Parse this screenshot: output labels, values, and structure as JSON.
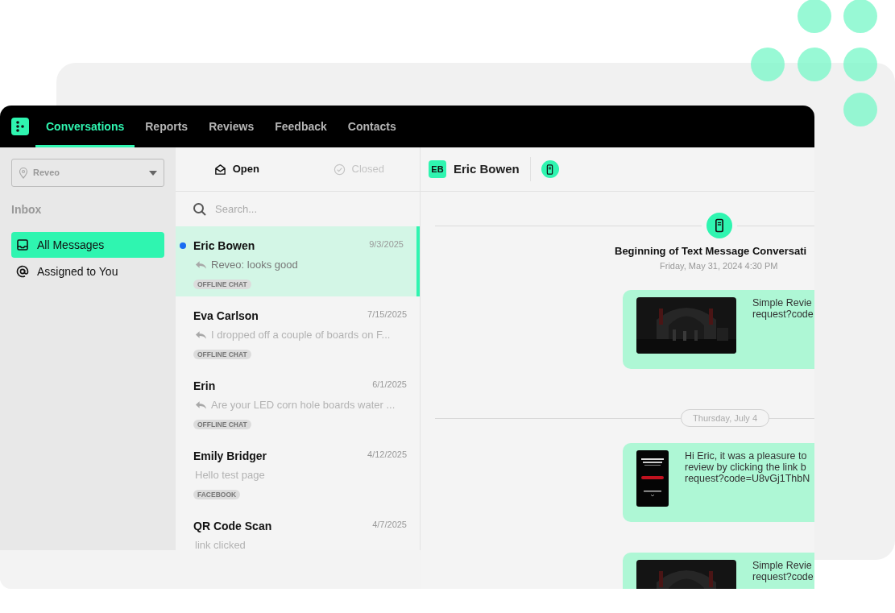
{
  "nav": {
    "tabs": [
      {
        "label": "Conversations",
        "selected": true
      },
      {
        "label": "Reports",
        "selected": false
      },
      {
        "label": "Reviews",
        "selected": false
      },
      {
        "label": "Feedback",
        "selected": false
      },
      {
        "label": "Contacts",
        "selected": false
      }
    ]
  },
  "sidebar": {
    "location": "Reveo",
    "heading": "Inbox",
    "items": [
      {
        "label": "All Messages",
        "kind": "inbox",
        "selected": true
      },
      {
        "label": "Assigned to You",
        "kind": "mention",
        "selected": false
      }
    ]
  },
  "filters": [
    {
      "label": "Open",
      "kind": "open",
      "selected": true
    },
    {
      "label": "Closed",
      "kind": "closed",
      "selected": false
    }
  ],
  "search": {
    "placeholder": "Search..."
  },
  "conversations": [
    {
      "name": "Eric Bowen",
      "date": "9/3/2025",
      "preview": "Reveo: looks good",
      "reply": true,
      "tag": "OFFLINE CHAT",
      "unread": true,
      "selected": true
    },
    {
      "name": "Eva Carlson",
      "date": "7/15/2025",
      "preview": "I dropped off a couple of boards on F...",
      "reply": true,
      "tag": "OFFLINE CHAT",
      "unread": false,
      "selected": false
    },
    {
      "name": "Erin",
      "date": "6/1/2025",
      "preview": "Are your LED corn hole boards water ...",
      "reply": true,
      "tag": "OFFLINE CHAT",
      "unread": false,
      "selected": false
    },
    {
      "name": "Emily Bridger",
      "date": "4/12/2025",
      "preview": "Hello test page",
      "reply": false,
      "tag": "FACEBOOK",
      "unread": false,
      "selected": false
    },
    {
      "name": "QR Code Scan",
      "date": "4/7/2025",
      "preview": "link clicked",
      "reply": false,
      "unread": false,
      "selected": false
    }
  ],
  "chat": {
    "contact": {
      "initials": "EB",
      "name": "Eric Bowen"
    },
    "items": [
      {
        "kind": "start",
        "title": "Beginning of Text Message Conversati",
        "subtitle": "Friday, May 31, 2024 4:30 PM"
      },
      {
        "kind": "message",
        "attachment": {
          "kind": "video"
        },
        "lines": [
          "Simple Revie",
          "request?code"
        ]
      },
      {
        "kind": "date",
        "label": "Thursday, July 4"
      },
      {
        "kind": "message",
        "attachment": {
          "kind": "poster"
        },
        "lines": [
          "Hi Eric, it was a pleasure to",
          "review by clicking the link b",
          "request?code=U8vGj1ThbN"
        ]
      },
      {
        "kind": "message",
        "attachment": {
          "kind": "video"
        },
        "lines": [
          "Simple Revie",
          "request?code"
        ]
      }
    ]
  }
}
